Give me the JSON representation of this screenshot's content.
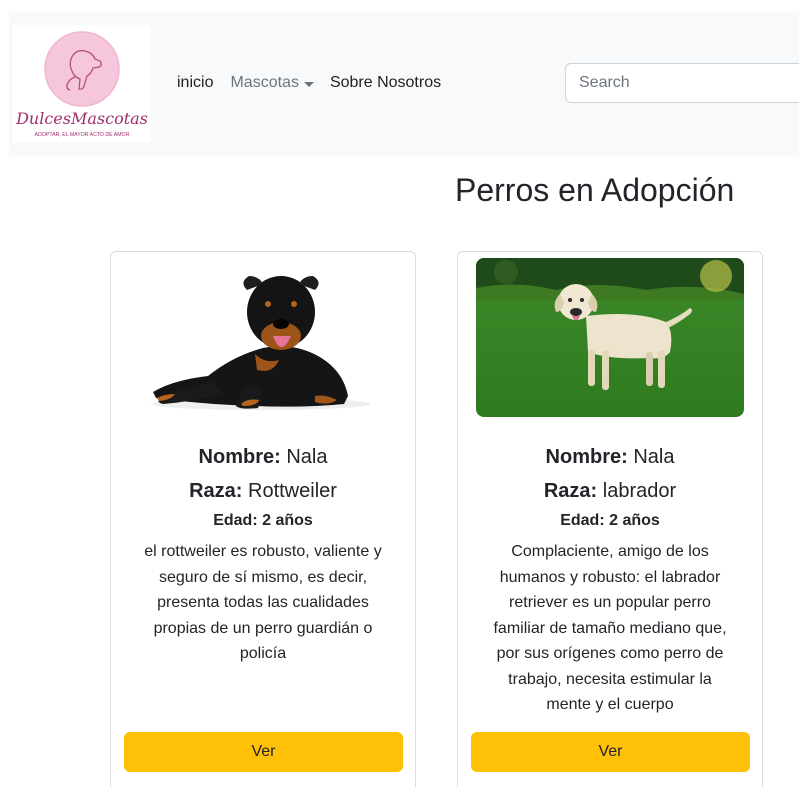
{
  "brand": {
    "name": "DulcesMascotas",
    "tagline": "ADOPTAR, EL MAYOR ACTO DE AMOR"
  },
  "nav": {
    "home": "inicio",
    "pets": "Mascotas",
    "about": "Sobre Nosotros"
  },
  "search": {
    "placeholder": "Search"
  },
  "page": {
    "title": "Perros en Adopción"
  },
  "cards": [
    {
      "name_label": "Nombre:",
      "name": "Nala",
      "breed_label": "Raza:",
      "breed": "Rottweiler",
      "age": "Edad: 2 años",
      "description": "el rottweiler es robusto, valiente y seguro de sí mismo, es decir, presenta todas las cualidades propias de un perro guardián o policía",
      "button": "Ver"
    },
    {
      "name_label": "Nombre:",
      "name": "Nala",
      "breed_label": "Raza:",
      "breed": "labrador",
      "age": "Edad: 2 años",
      "description": "Complaciente, amigo de los humanos y robusto: el labrador retriever es un popular perro familiar de tamaño mediano que, por sus orígenes como perro de trabajo, necesita estimular la mente y el cuerpo",
      "button": "Ver"
    }
  ],
  "colors": {
    "navbar_bg": "#f8f9fa",
    "button_bg": "#ffc107",
    "logo_pink": "#f6c6dc",
    "logo_text": "#a0306a"
  }
}
